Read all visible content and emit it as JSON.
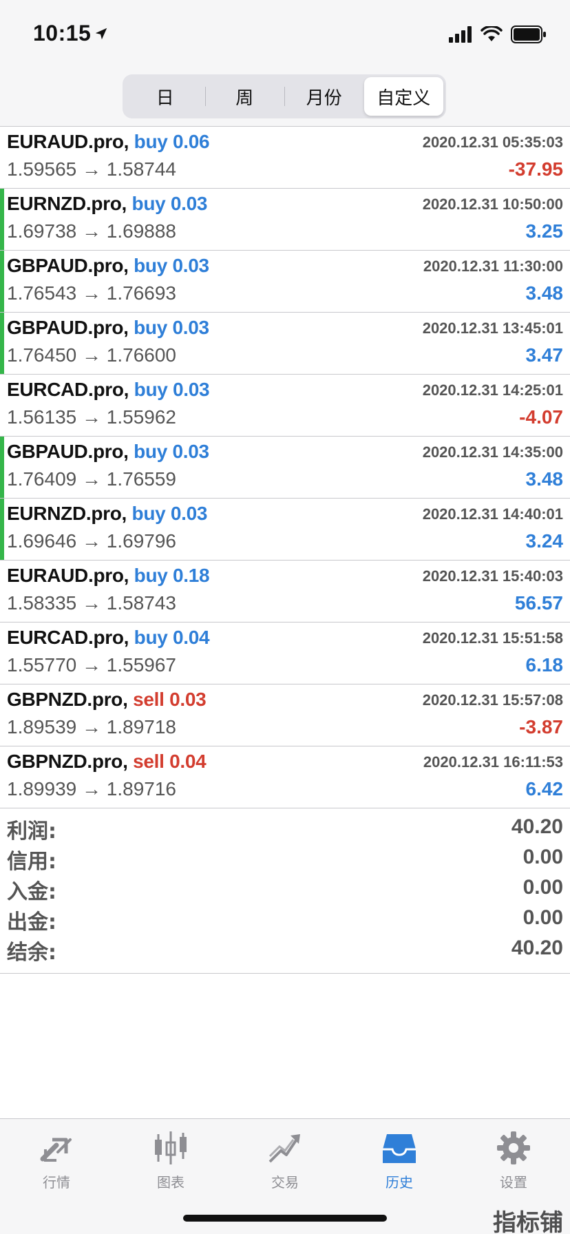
{
  "status": {
    "time": "10:15"
  },
  "period_tabs": [
    {
      "label": "日"
    },
    {
      "label": "周"
    },
    {
      "label": "月份"
    },
    {
      "label": "自定义",
      "active": true
    }
  ],
  "deals": [
    {
      "symbol": "EURAUD.pro,",
      "side": "buy",
      "volume": "0.06",
      "time": "2020.12.31 05:35:03",
      "prices": "1.59565 → 1.58744",
      "profit": "-37.95",
      "marked": false
    },
    {
      "symbol": "EURNZD.pro,",
      "side": "buy",
      "volume": "0.03",
      "time": "2020.12.31 10:50:00",
      "prices": "1.69738 → 1.69888",
      "profit": "3.25",
      "marked": true
    },
    {
      "symbol": "GBPAUD.pro,",
      "side": "buy",
      "volume": "0.03",
      "time": "2020.12.31 11:30:00",
      "prices": "1.76543 → 1.76693",
      "profit": "3.48",
      "marked": true
    },
    {
      "symbol": "GBPAUD.pro,",
      "side": "buy",
      "volume": "0.03",
      "time": "2020.12.31 13:45:01",
      "prices": "1.76450 → 1.76600",
      "profit": "3.47",
      "marked": true
    },
    {
      "symbol": "EURCAD.pro,",
      "side": "buy",
      "volume": "0.03",
      "time": "2020.12.31 14:25:01",
      "prices": "1.56135 → 1.55962",
      "profit": "-4.07",
      "marked": false
    },
    {
      "symbol": "GBPAUD.pro,",
      "side": "buy",
      "volume": "0.03",
      "time": "2020.12.31 14:35:00",
      "prices": "1.76409 → 1.76559",
      "profit": "3.48",
      "marked": true
    },
    {
      "symbol": "EURNZD.pro,",
      "side": "buy",
      "volume": "0.03",
      "time": "2020.12.31 14:40:01",
      "prices": "1.69646 → 1.69796",
      "profit": "3.24",
      "marked": true
    },
    {
      "symbol": "EURAUD.pro,",
      "side": "buy",
      "volume": "0.18",
      "time": "2020.12.31 15:40:03",
      "prices": "1.58335 → 1.58743",
      "profit": "56.57",
      "marked": false
    },
    {
      "symbol": "EURCAD.pro,",
      "side": "buy",
      "volume": "0.04",
      "time": "2020.12.31 15:51:58",
      "prices": "1.55770 → 1.55967",
      "profit": "6.18",
      "marked": false
    },
    {
      "symbol": "GBPNZD.pro,",
      "side": "sell",
      "volume": "0.03",
      "time": "2020.12.31 15:57:08",
      "prices": "1.89539 → 1.89718",
      "profit": "-3.87",
      "marked": false
    },
    {
      "symbol": "GBPNZD.pro,",
      "side": "sell",
      "volume": "0.04",
      "time": "2020.12.31 16:11:53",
      "prices": "1.89939 → 1.89716",
      "profit": "6.42",
      "marked": false
    }
  ],
  "summary": [
    {
      "label": "利润:",
      "value": "40.20"
    },
    {
      "label": "信用:",
      "value": "0.00"
    },
    {
      "label": "入金:",
      "value": "0.00"
    },
    {
      "label": "出金:",
      "value": "0.00"
    },
    {
      "label": "结余:",
      "value": "40.20"
    }
  ],
  "tabbar": [
    {
      "label": "行情",
      "icon": "quotes-icon"
    },
    {
      "label": "图表",
      "icon": "chart-icon"
    },
    {
      "label": "交易",
      "icon": "trade-icon"
    },
    {
      "label": "历史",
      "icon": "history-icon",
      "active": true
    },
    {
      "label": "设置",
      "icon": "settings-icon"
    }
  ],
  "watermark": "指标铺",
  "colors": {
    "buy": "#2f7fd8",
    "sell": "#d33d2f",
    "marker": "#35b64a",
    "inactive_tab": "#8e8e93"
  }
}
